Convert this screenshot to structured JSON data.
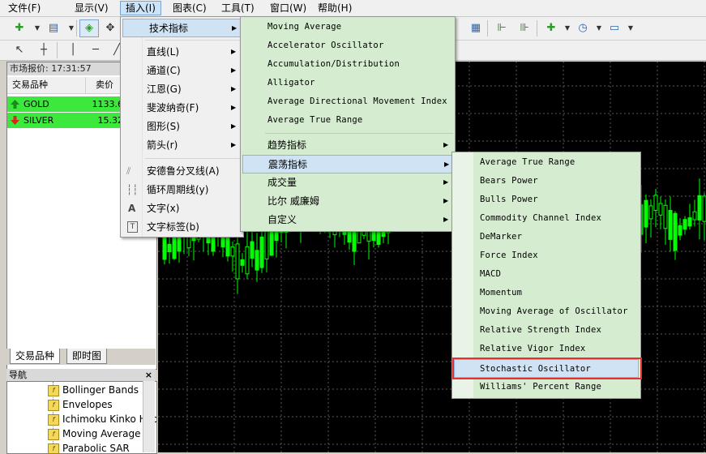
{
  "menubar": {
    "items": [
      "文件(F)",
      "显示(V)",
      "插入(I)",
      "图表(C)",
      "工具(T)",
      "窗口(W)",
      "帮助(H)"
    ],
    "active_index": 2
  },
  "market_watch": {
    "title": "市场报价: 17:31:57",
    "col_symbol": "交易品种",
    "col_bid": "卖价",
    "rows": [
      {
        "symbol": "GOLD",
        "bid": "1133.6",
        "direction": "up"
      },
      {
        "symbol": "SILVER",
        "bid": "15.32",
        "direction": "down"
      }
    ],
    "tabs": [
      "交易品种",
      "即时图"
    ]
  },
  "navigator": {
    "title": "导航",
    "close": "×",
    "items": [
      "Bollinger Bands",
      "Envelopes",
      "Ichimoku Kinko Hyo",
      "Moving Average",
      "Parabolic SAR"
    ]
  },
  "insert_menu": {
    "items": [
      {
        "label": "技术指标",
        "submenu": true
      },
      {
        "label": "直线(L)",
        "submenu": true
      },
      {
        "label": "通道(C)",
        "submenu": true
      },
      {
        "label": "江恩(G)",
        "submenu": true
      },
      {
        "label": "斐波纳奇(F)",
        "submenu": true
      },
      {
        "label": "图形(S)",
        "submenu": true
      },
      {
        "label": "箭头(r)",
        "submenu": true
      },
      {
        "label": "安德鲁分叉线(A)",
        "icon": "andrews-pitchfork-icon"
      },
      {
        "label": "循环周期线(y)",
        "icon": "cycle-lines-icon"
      },
      {
        "label": "文字(x)",
        "icon": "text-icon",
        "glyph": "A"
      },
      {
        "label": "文字标签(b)",
        "icon": "text-label-icon",
        "glyph": "T"
      }
    ]
  },
  "indicators_menu": {
    "items": [
      "Moving Average",
      "Accelerator Oscillator",
      "Accumulation/Distribution",
      "Alligator",
      "Average Directional Movement Index",
      "Average True Range"
    ],
    "groups": [
      "趋势指标",
      "震荡指标",
      "成交量",
      "比尔 威廉姆",
      "自定义"
    ]
  },
  "oscillators_menu": {
    "items": [
      "Average True Range",
      "Bears Power",
      "Bulls Power",
      "Commodity Channel Index",
      "DeMarker",
      "Force Index",
      "MACD",
      "Momentum",
      "Moving Average of Oscillator",
      "Relative Strength Index",
      "Relative Vigor Index",
      "Stochastic Oscillator",
      "Williams' Percent Range"
    ],
    "selected_index": 11
  },
  "colors": {
    "chart_bg": "#000000",
    "candle": "#00ff00",
    "grid": "#5a5a5a",
    "menu_highlight": "#cfe3f5",
    "callout": "#e5302e",
    "market_row": "#3de83d"
  }
}
